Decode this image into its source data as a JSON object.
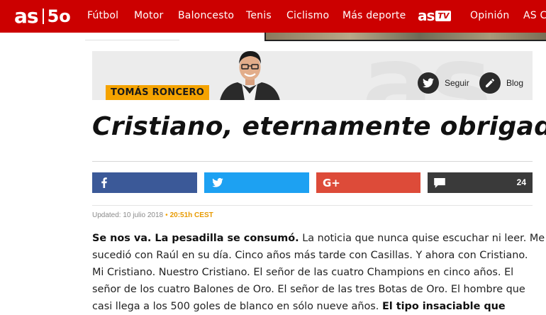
{
  "header": {
    "logo_main": "as",
    "logo_anniversary": "5o",
    "nav": [
      "Fútbol",
      "Motor",
      "Baloncesto",
      "Tenis",
      "Ciclismo",
      "Más deporte",
      "Opinión",
      "AS Co"
    ],
    "astv_logo": "as",
    "astv_badge": "TV"
  },
  "author": {
    "name": "TOMÁS RONCERO",
    "follow_label": "Seguir",
    "blog_label": "Blog"
  },
  "article": {
    "title": "Cristiano, eternamente obrigado",
    "updated_label": "Updated: 10 julio 2018",
    "updated_time": "20:51h CEST",
    "lead_bold": "Se nos va. La pesadilla se consumó.",
    "line1_rest": " La noticia que nunca quise escuchar ni leer. Me",
    "line2": "sucedió con Raúl en su día. Cinco años más tarde con Casillas. Y ahora con Cristiano.",
    "line3": "Mi Cristiano. Nuestro Cristiano. El señor de las cuatro Champions en cinco años. El",
    "line4": "señor de los cuatro Balones de Oro. El señor de las tres Botas de Oro. El hombre que",
    "line5_normal": "casi llega a los 500 goles de blanco en sólo nueve años. ",
    "line5_bold": "El tipo insaciable que"
  },
  "share": {
    "comment_count": "24"
  },
  "colors": {
    "brand_red": "#cc0000",
    "facebook": "#3b5998",
    "twitter": "#1da1f2",
    "googleplus": "#dd4b39",
    "comments": "#3a3a3a",
    "author_tag": "#f5a300"
  }
}
